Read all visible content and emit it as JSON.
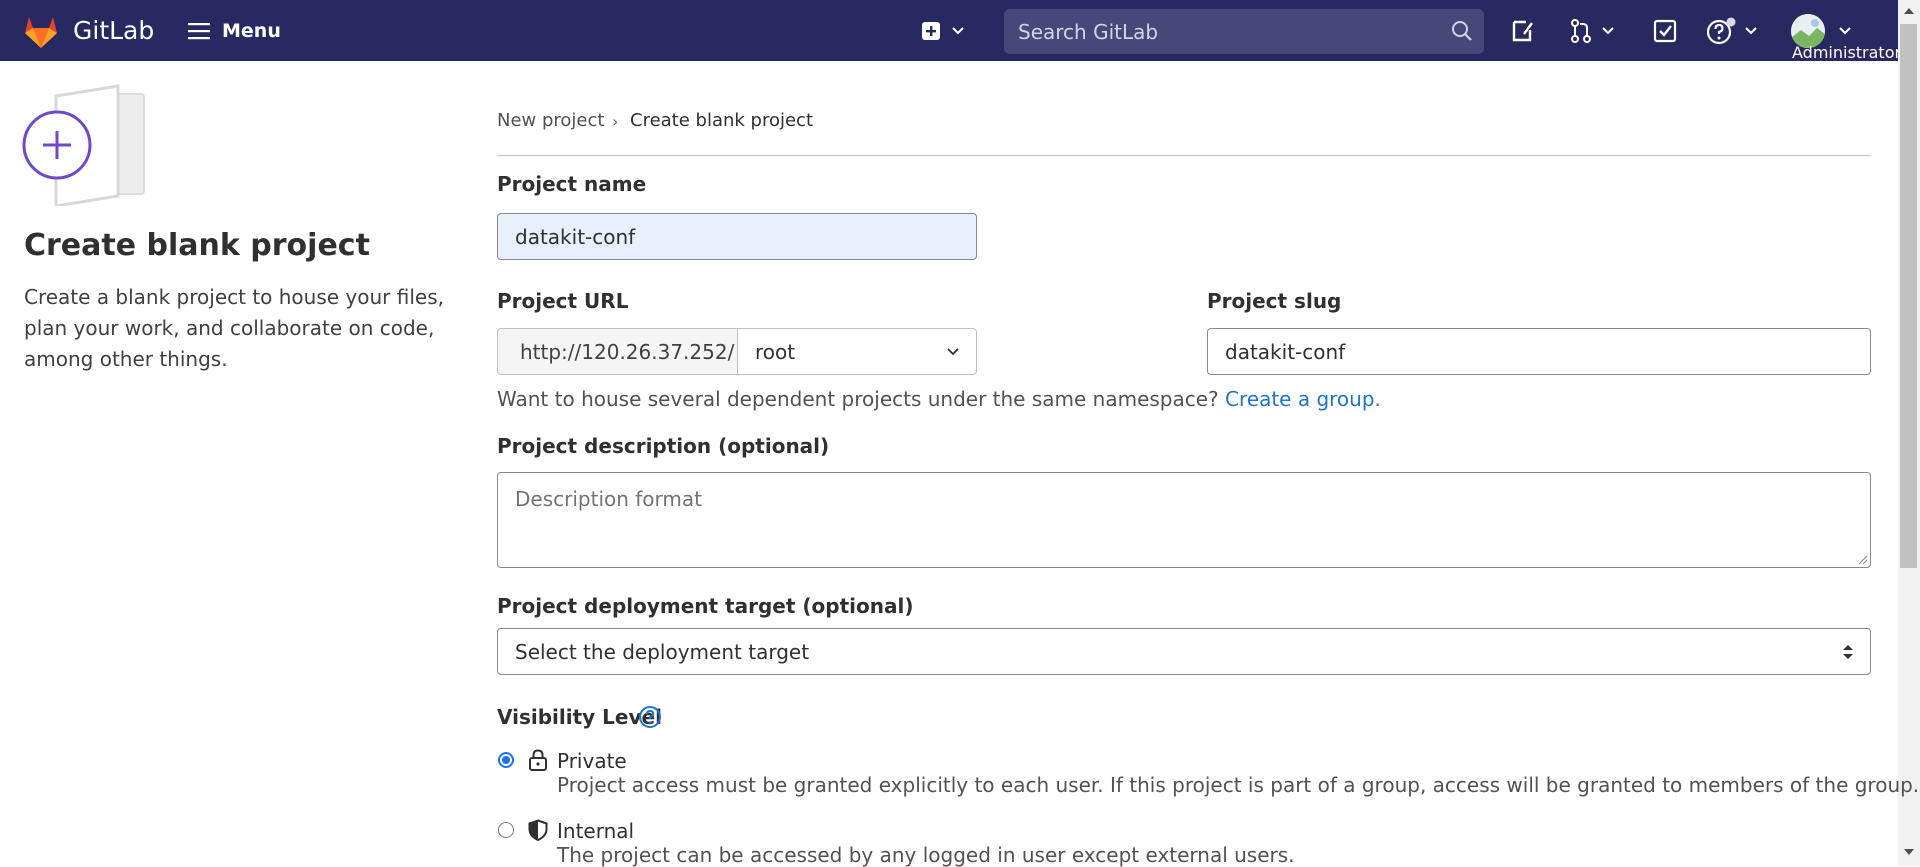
{
  "navbar": {
    "brand": "GitLab",
    "menu_label": "Menu",
    "search_placeholder": "Search GitLab",
    "user_name": "Administrator",
    "colors": {
      "background": "#292961",
      "search_bg": "#47477a"
    },
    "icons": [
      "gitlab-logo-icon",
      "hamburger-icon",
      "plus-square-icon",
      "search-icon",
      "issues-icon",
      "merge-request-icon",
      "todo-icon",
      "help-icon",
      "avatar"
    ]
  },
  "sidebar": {
    "title": "Create blank project",
    "description": "Create a blank project to house your files, plan your work, and collaborate on code, among other things."
  },
  "breadcrumb": {
    "items": [
      "New project",
      "Create blank project"
    ],
    "separator": "›"
  },
  "form": {
    "project_name": {
      "label": "Project name",
      "value": "datakit-conf"
    },
    "project_url": {
      "label": "Project URL",
      "prefix": "http://120.26.37.252/",
      "namespace": "root"
    },
    "project_slug": {
      "label": "Project slug",
      "value": "datakit-conf"
    },
    "namespace_help": {
      "text": "Want to house several dependent projects under the same namespace?",
      "link": "Create a group."
    },
    "description": {
      "label": "Project description (optional)",
      "placeholder": "Description format"
    },
    "deployment": {
      "label": "Project deployment target (optional)",
      "selected": "Select the deployment target"
    },
    "visibility": {
      "label": "Visibility Level",
      "options": [
        {
          "title": "Private",
          "description": "Project access must be granted explicitly to each user. If this project is part of a group, access will be granted to members of the group.",
          "checked": true,
          "icon": "lock-icon"
        },
        {
          "title": "Internal",
          "description": "The project can be accessed by any logged in user except external users.",
          "checked": false,
          "icon": "shield-icon"
        }
      ]
    }
  },
  "colors": {
    "link": "#1f75cb",
    "accent_purple": "#6e49cb",
    "radio_checked": "#1a73e8"
  }
}
